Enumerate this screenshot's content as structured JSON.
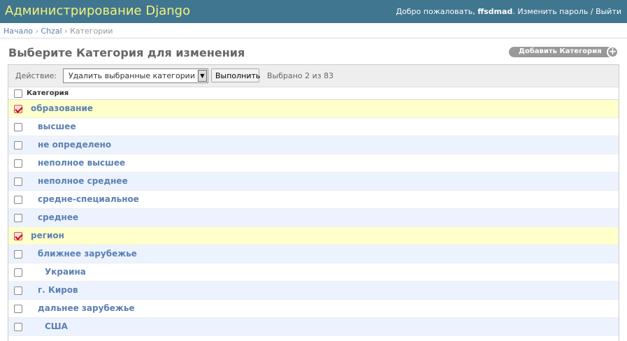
{
  "header": {
    "brand": "Администрирование Django",
    "welcome": "Добро пожаловать,",
    "username": "ffsdmad",
    "change_password": "Изменить пароль",
    "separator": "/",
    "logout": "Выйти"
  },
  "breadcrumbs": {
    "home": "Начало",
    "app": "Chzal",
    "current": "Категории",
    "sep": "›"
  },
  "page": {
    "title": "Выберите Категория для изменения",
    "add_button": "Добавить Категория",
    "add_icon": "plus-icon"
  },
  "actions": {
    "label": "Действие:",
    "selected_action": "Удалить выбранные категории",
    "go_button": "Выполнить",
    "selected_count": "Выбрано 2 из 83"
  },
  "table": {
    "column_header": "Категория",
    "rows": [
      {
        "label": "образование",
        "level": 0,
        "checked": true
      },
      {
        "label": "высшее",
        "level": 1,
        "checked": false
      },
      {
        "label": "не определено",
        "level": 1,
        "checked": false
      },
      {
        "label": "неполное высшее",
        "level": 1,
        "checked": false
      },
      {
        "label": "неполное среднее",
        "level": 1,
        "checked": false
      },
      {
        "label": "средне-специальное",
        "level": 1,
        "checked": false
      },
      {
        "label": "среднее",
        "level": 1,
        "checked": false
      },
      {
        "label": "регион",
        "level": 0,
        "checked": true
      },
      {
        "label": "ближнее зарубежье",
        "level": 1,
        "checked": false
      },
      {
        "label": "Украина",
        "level": 2,
        "checked": false
      },
      {
        "label": "г. Киров",
        "level": 1,
        "checked": false
      },
      {
        "label": "дальнее зарубежье",
        "level": 1,
        "checked": false
      },
      {
        "label": "США",
        "level": 2,
        "checked": false
      }
    ]
  },
  "colors": {
    "header_bg": "#417690",
    "brand_text": "#f4f379",
    "link": "#5b80b2",
    "row_alt": "#edf3fe",
    "row_selected": "#ffffcc"
  }
}
